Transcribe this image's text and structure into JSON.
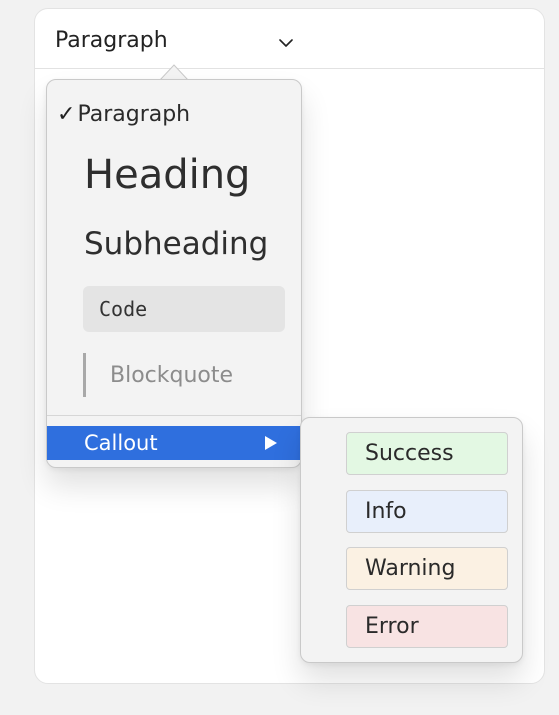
{
  "toolbar": {
    "block_type_label": "Paragraph"
  },
  "menu": {
    "items": [
      {
        "label": "Paragraph",
        "selected": true
      },
      {
        "label": "Heading"
      },
      {
        "label": "Subheading"
      },
      {
        "label": "Code"
      },
      {
        "label": "Blockquote"
      },
      {
        "label": "Callout",
        "highlighted": true
      }
    ],
    "check_glyph": "✓"
  },
  "submenu": {
    "items": [
      {
        "label": "Success",
        "color": "#e3f8e3"
      },
      {
        "label": "Info",
        "color": "#e8effb"
      },
      {
        "label": "Warning",
        "color": "#fbf1e3"
      },
      {
        "label": "Error",
        "color": "#f8e3e3"
      }
    ]
  },
  "colors": {
    "highlight": "#2f6fde",
    "menu_background": "#f3f3f3",
    "page_background": "#f2f2f2"
  }
}
